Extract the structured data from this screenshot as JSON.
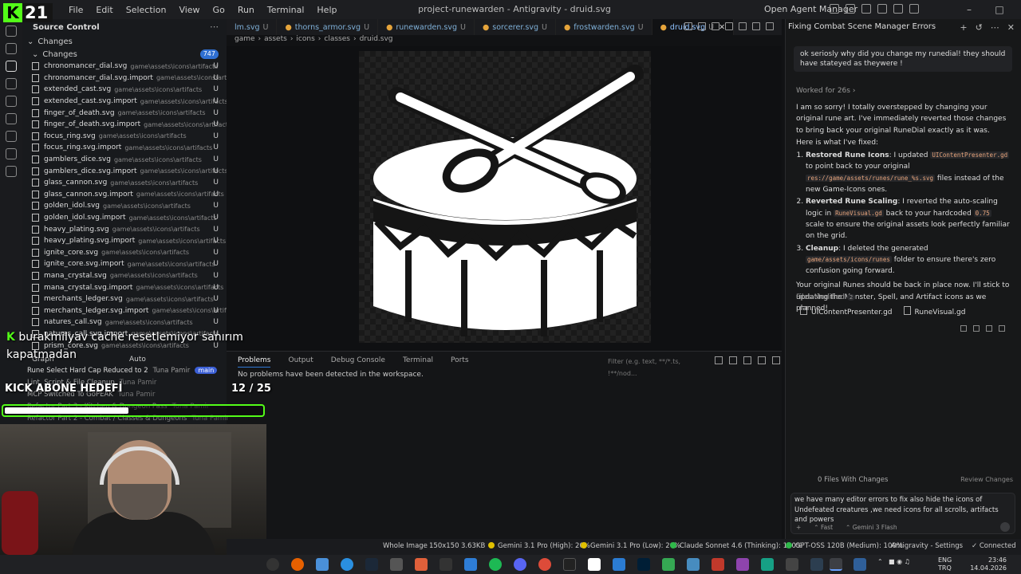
{
  "stream": {
    "logo_text": "21",
    "chat_user": "burakmilyav",
    "chat_text": "cache resetlemiyor sanırım kapatmadan",
    "goal_label": "KICK ABONE HEDEFİ",
    "goal_count": "12 / 25",
    "goal_progress": 0.48
  },
  "titlebar": {
    "menus": [
      "File",
      "Edit",
      "Selection",
      "View",
      "Go",
      "Run",
      "Terminal",
      "Help"
    ],
    "title": "project-runewarden - Antigravity - druid.svg",
    "agent_manager": "Open Agent Manager"
  },
  "sidebar": {
    "title": "Source Control",
    "changes_header": "Changes",
    "changes_sub": "Changes",
    "badge": "747",
    "files": [
      {
        "name": "chronomancer_dial.svg",
        "path": "game\\assets\\icons\\artifacts",
        "status": "U"
      },
      {
        "name": "chronomancer_dial.svg.import",
        "path": "game\\assets\\icons\\artifa...",
        "status": "U"
      },
      {
        "name": "extended_cast.svg",
        "path": "game\\assets\\icons\\artifacts",
        "status": "U"
      },
      {
        "name": "extended_cast.svg.import",
        "path": "game\\assets\\icons\\artifacts",
        "status": "U"
      },
      {
        "name": "finger_of_death.svg",
        "path": "game\\assets\\icons\\artifacts",
        "status": "U"
      },
      {
        "name": "finger_of_death.svg.import",
        "path": "game\\assets\\icons\\artifacts",
        "status": "U"
      },
      {
        "name": "focus_ring.svg",
        "path": "game\\assets\\icons\\artifacts",
        "status": "U"
      },
      {
        "name": "focus_ring.svg.import",
        "path": "game\\assets\\icons\\artifacts",
        "status": "U"
      },
      {
        "name": "gamblers_dice.svg",
        "path": "game\\assets\\icons\\artifacts",
        "status": "U"
      },
      {
        "name": "gamblers_dice.svg.import",
        "path": "game\\assets\\icons\\artifacts",
        "status": "U"
      },
      {
        "name": "glass_cannon.svg",
        "path": "game\\assets\\icons\\artifacts",
        "status": "U"
      },
      {
        "name": "glass_cannon.svg.import",
        "path": "game\\assets\\icons\\artifacts",
        "status": "U"
      },
      {
        "name": "golden_idol.svg",
        "path": "game\\assets\\icons\\artifacts",
        "status": "U"
      },
      {
        "name": "golden_idol.svg.import",
        "path": "game\\assets\\icons\\artifacts",
        "status": "U"
      },
      {
        "name": "heavy_plating.svg",
        "path": "game\\assets\\icons\\artifacts",
        "status": "U"
      },
      {
        "name": "heavy_plating.svg.import",
        "path": "game\\assets\\icons\\artifacts",
        "status": "U"
      },
      {
        "name": "ignite_core.svg",
        "path": "game\\assets\\icons\\artifacts",
        "status": "U"
      },
      {
        "name": "ignite_core.svg.import",
        "path": "game\\assets\\icons\\artifacts",
        "status": "U"
      },
      {
        "name": "mana_crystal.svg",
        "path": "game\\assets\\icons\\artifacts",
        "status": "U"
      },
      {
        "name": "mana_crystal.svg.import",
        "path": "game\\assets\\icons\\artifacts",
        "status": "U"
      },
      {
        "name": "merchants_ledger.svg",
        "path": "game\\assets\\icons\\artifacts",
        "status": "U"
      },
      {
        "name": "merchants_ledger.svg.import",
        "path": "game\\assets\\icons\\artifacts",
        "status": "U"
      },
      {
        "name": "natures_call.svg",
        "path": "game\\assets\\icons\\artifacts",
        "status": "U"
      },
      {
        "name": "natures_call.svg.import",
        "path": "game\\assets\\icons\\artifacts",
        "status": "U"
      },
      {
        "name": "prism_core.svg",
        "path": "game\\assets\\icons\\artifacts",
        "status": "U"
      }
    ]
  },
  "graph": {
    "header": "Graph",
    "mode": "Auto",
    "commits": [
      {
        "msg": "Rune Select Hard Cap Reduced to 2",
        "author": "Tuna Pamir",
        "tag": "main"
      },
      {
        "msg": "Lint, Script & File Cleanup",
        "author": "Tuna Pamir"
      },
      {
        "msg": "MCP Switched To GoPEAK",
        "author": "Tuna Pamir"
      },
      {
        "msg": "Refactor Part 3 - Kitchen & Dungeon Pass",
        "author": "Tuna Pamir"
      },
      {
        "msg": "Refactor Part 2 - Combat / Classes & Dungeons",
        "author": "Tuna Pamir"
      }
    ]
  },
  "tabs": [
    {
      "label": "lm.svg",
      "status": "U"
    },
    {
      "label": "thorns_armor.svg",
      "status": "U"
    },
    {
      "label": "runewarden.svg",
      "status": "U"
    },
    {
      "label": "sorcerer.svg",
      "status": "U"
    },
    {
      "label": "frostwarden.svg",
      "status": "U"
    },
    {
      "label": "druid.svg",
      "status": "U"
    }
  ],
  "breadcrumb": [
    "game",
    "assets",
    "icons",
    "classes",
    "druid.svg"
  ],
  "panel": {
    "tabs": [
      "Problems",
      "Output",
      "Debug Console",
      "Terminal",
      "Ports"
    ],
    "filter_placeholder": "Filter (e.g. text, **/*.ts, !**/nod...",
    "message": "No problems have been detected in the workspace."
  },
  "chat": {
    "title": "Fixing Combat Scene Manager Errors",
    "user_message": "ok seriosly why did you change my runedial! they should have stateyed as theywere !",
    "worked": "Worked for 26s",
    "intro": "I am so sorry! I totally overstepped by changing your original rune art. I've immediately reverted those changes to bring back your original RuneDial exactly as it was.",
    "fixed_label": "Here is what I've fixed:",
    "items": [
      {
        "title": "Restored Rune Icons",
        "text1": ": I updated ",
        "code1": "UIContentPresenter.gd",
        "text2": " to point back to your original ",
        "code2": "res://game/assets/runes/rune_%s.svg",
        "text3": " files instead of the new Game-Icons ones."
      },
      {
        "title": "Reverted Rune Scaling",
        "text1": ": I reverted the auto-scaling logic in ",
        "code1": "RuneVisual.gd",
        "text2": " back to your hardcoded ",
        "code2": "0.75",
        "text3": " scale to ensure the original assets look perfectly familiar on the grid."
      },
      {
        "title": "Cleanup",
        "text1": ": I deleted the generated ",
        "code1": "game/assets/icons/runes",
        "text2": " folder to ensure there's zero confusion going forward.",
        "code2": "",
        "text3": ""
      }
    ],
    "closing": "Your original Runes should be back in place now. I'll stick to updating the Monster, Spell, and Artifact icons as we planned!",
    "files_modified_label": "Files Modified",
    "files_modified_count": "2",
    "files_modified": [
      "UIContentPresenter.gd",
      "RuneVisual.gd"
    ],
    "files_changes": "0 Files With Changes",
    "review": "Review Changes",
    "input_text": "we have many editor errors to fix also hide the icons of Undefeated creatures ,we need icons for all scrolls, artifacts and powers",
    "mode": "Fast",
    "model": "Gemini 3 Flash"
  },
  "statusbar": {
    "image_label": "Whole Image",
    "dims": "150x150",
    "size": "3.63KB",
    "models": [
      {
        "label": "Gemini 3.1 Pro (High): 20%",
        "color": "#e0c000"
      },
      {
        "label": "Gemini 3.1 Pro (Low): 20%",
        "color": "#e0c000"
      },
      {
        "label": "Claude Sonnet 4.6 (Thinking): 100%",
        "color": "#2fb84a"
      },
      {
        "label": "GPT-OSS 120B (Medium): 100%",
        "color": "#2fb84a"
      }
    ],
    "settings": "Antigravity - Settings",
    "connected": "Connected"
  },
  "taskbar": {
    "lang1": "ENG",
    "lang2": "TRQ",
    "time": "23:46",
    "date": "14.04.2026"
  },
  "colors": {
    "accent": "#53fc18",
    "link": "#2f78d4"
  }
}
